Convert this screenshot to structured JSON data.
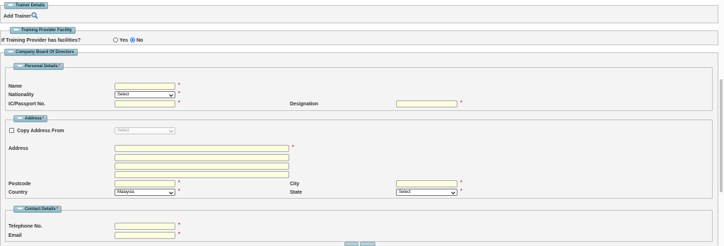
{
  "trainer_details": {
    "legend": "Trainer Details",
    "add_trainer_label": "Add Trainer",
    "search_icon": "magnifier-icon"
  },
  "training_provider": {
    "legend": "Training Provider Facility",
    "question": "If Training Provider has facilities?",
    "yes_label": "Yes",
    "no_label": "No",
    "selected": "No"
  },
  "board": {
    "legend": "Company Board Of Directors",
    "personal": {
      "legend": "Personal Details",
      "name_label": "Name",
      "nationality_label": "Nationality",
      "nationality_value": "Select",
      "ic_label": "IC/Passport No.",
      "designation_label": "Designation"
    },
    "address": {
      "legend": "Address",
      "copy_label": "Copy Address From",
      "copy_select": "Select",
      "address_label": "Address",
      "postcode_label": "Postcode",
      "city_label": "City",
      "country_label": "Country",
      "country_value": "Malaysia",
      "state_label": "State",
      "state_value": "Select"
    },
    "contact": {
      "legend": "Contact Details",
      "telephone_label": "Telephone No.",
      "email_label": "Email"
    }
  },
  "required_mark": "*",
  "colors": {
    "legend_bg": "#a9c8d2",
    "input_bg": "#fefee0",
    "required": "#d02020",
    "accent": "#1a73e8"
  }
}
